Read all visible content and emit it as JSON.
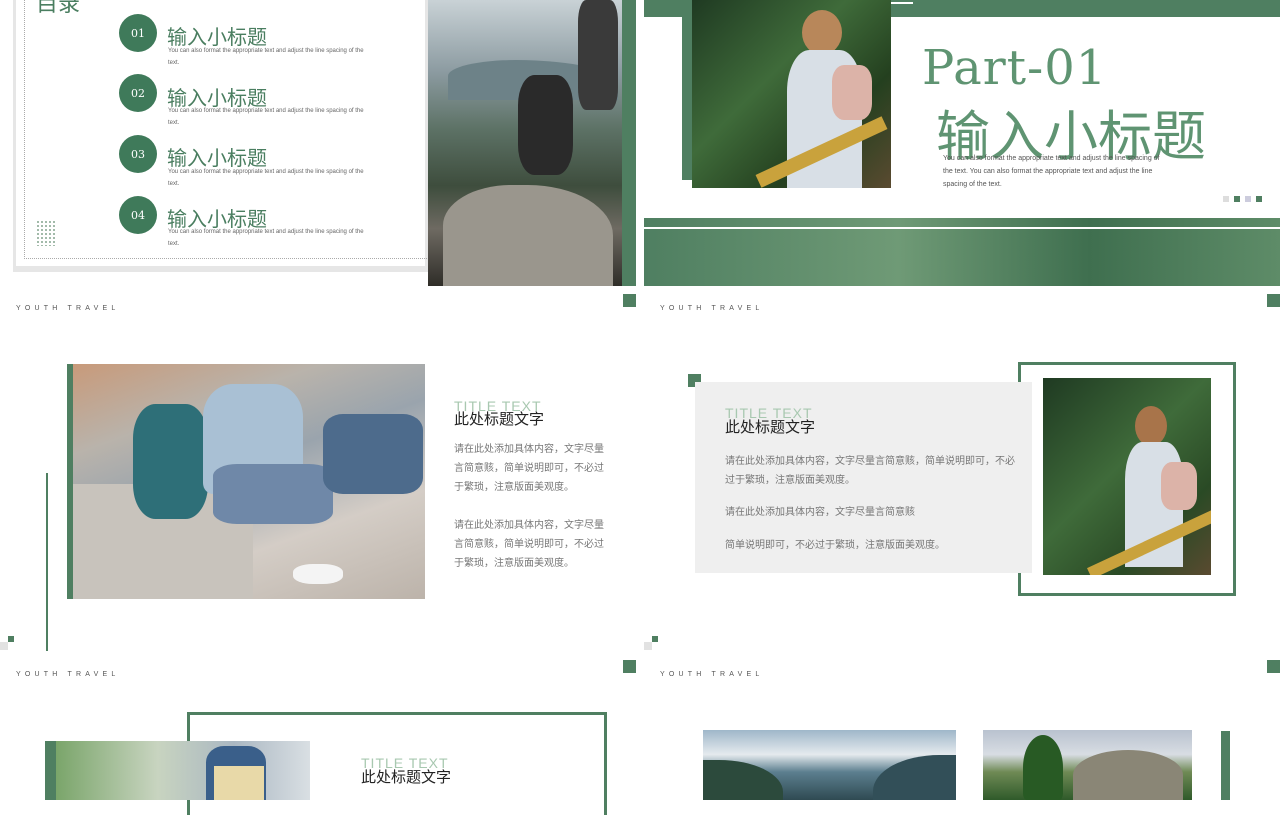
{
  "brand_text": "YOUTH  TRAVEL",
  "colors": {
    "accent": "#4f7f61",
    "accent_dark": "#3f7a5a",
    "panel_gray": "#efefef"
  },
  "slide1": {
    "heading_fragment": "目录",
    "items": [
      {
        "num": "01",
        "title": "输入小标题",
        "desc": "You can also format the appropriate text and adjust the line spacing of the text."
      },
      {
        "num": "02",
        "title": "输入小标题",
        "desc": "You can also format the appropriate text and adjust the line spacing of the text."
      },
      {
        "num": "03",
        "title": "输入小标题",
        "desc": "You can also format the appropriate text and adjust the line spacing of the text."
      },
      {
        "num": "04",
        "title": "输入小标题",
        "desc": "You can also format the appropriate text and adjust the line spacing of the text."
      }
    ]
  },
  "slide2": {
    "part": "Part-01",
    "title": "输入小标题",
    "desc": "You can also format the appropriate text and adjust the line spacing of the text. You can also format the appropriate text and adjust the line spacing of the text."
  },
  "slide3": {
    "ghost": "TITLE TEXT",
    "title": "此处标题文字",
    "para1": "请在此处添加具体内容，文字尽量言简意赅，简单说明即可，不必过于繁琐，注意版面美观度。",
    "para2": "请在此处添加具体内容，文字尽量言简意赅，简单说明即可，不必过于繁琐，注意版面美观度。"
  },
  "slide4": {
    "ghost": "TITLE TEXT",
    "title": "此处标题文字",
    "para1": "请在此处添加具体内容，文字尽量言简意赅，简单说明即可，不必过于繁琐，注意版面美观度。",
    "para2": "请在此处添加具体内容，文字尽量言简意赅",
    "para3": "简单说明即可，不必过于繁琐，注意版面美观度。"
  },
  "slide5": {
    "ghost": "TITLE TEXT",
    "title": "此处标题文字"
  }
}
